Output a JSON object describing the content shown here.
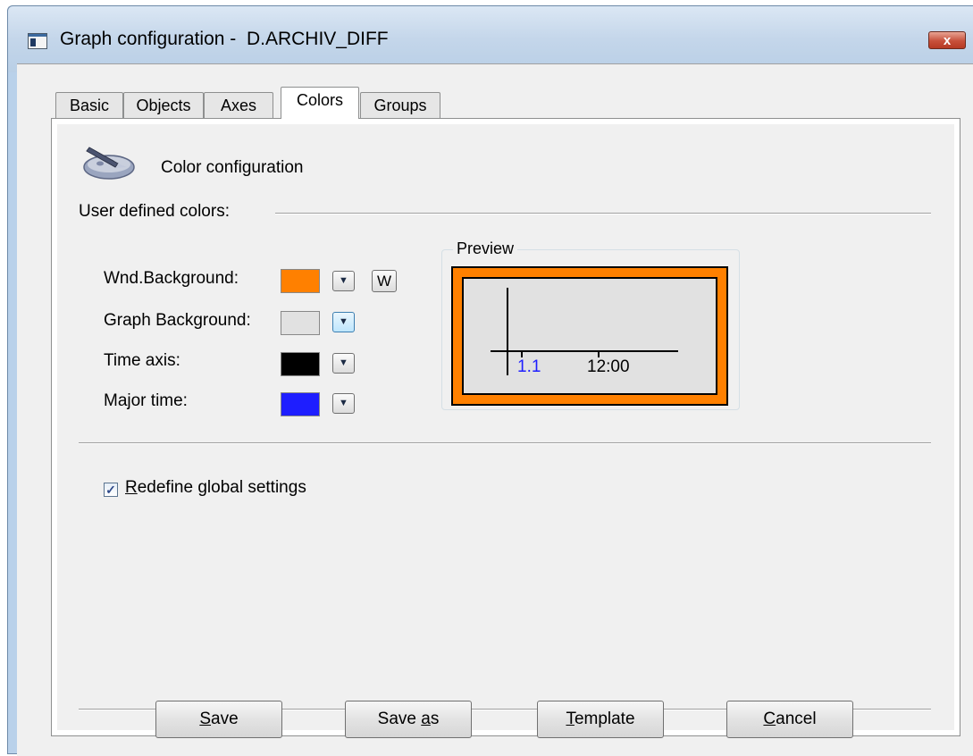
{
  "window": {
    "title": "Graph configuration -  D.ARCHIV_DIFF",
    "close_label": "x"
  },
  "tabs": [
    {
      "label": "Basic",
      "active": false
    },
    {
      "label": "Objects",
      "active": false
    },
    {
      "label": "Axes",
      "active": false
    },
    {
      "label": "Colors",
      "active": true
    },
    {
      "label": "Groups",
      "active": false
    }
  ],
  "section": {
    "icon": "palette-icon",
    "title": "Color configuration",
    "group_label": "User defined colors:"
  },
  "color_rows": [
    {
      "label": "Wnd.Background:",
      "color": "#ff8000",
      "extra_button": "W"
    },
    {
      "label": "Graph Background:",
      "color": "#e1e1e1"
    },
    {
      "label": "Time axis:",
      "color": "#000000"
    },
    {
      "label": "Major time:",
      "color": "#1e1eff"
    }
  ],
  "preview": {
    "label": "Preview",
    "major_label": "1.1",
    "time_label": "12:00"
  },
  "checkbox": {
    "checked": true,
    "label_first": "R",
    "label_rest": "edefine global settings"
  },
  "buttons": {
    "save": {
      "u": "S",
      "rest": "ave"
    },
    "save_as": {
      "pre": "Save ",
      "u": "a",
      "rest": "s"
    },
    "template": {
      "u": "T",
      "rest": "emplate"
    },
    "cancel": {
      "u": "C",
      "rest": "ancel"
    }
  }
}
